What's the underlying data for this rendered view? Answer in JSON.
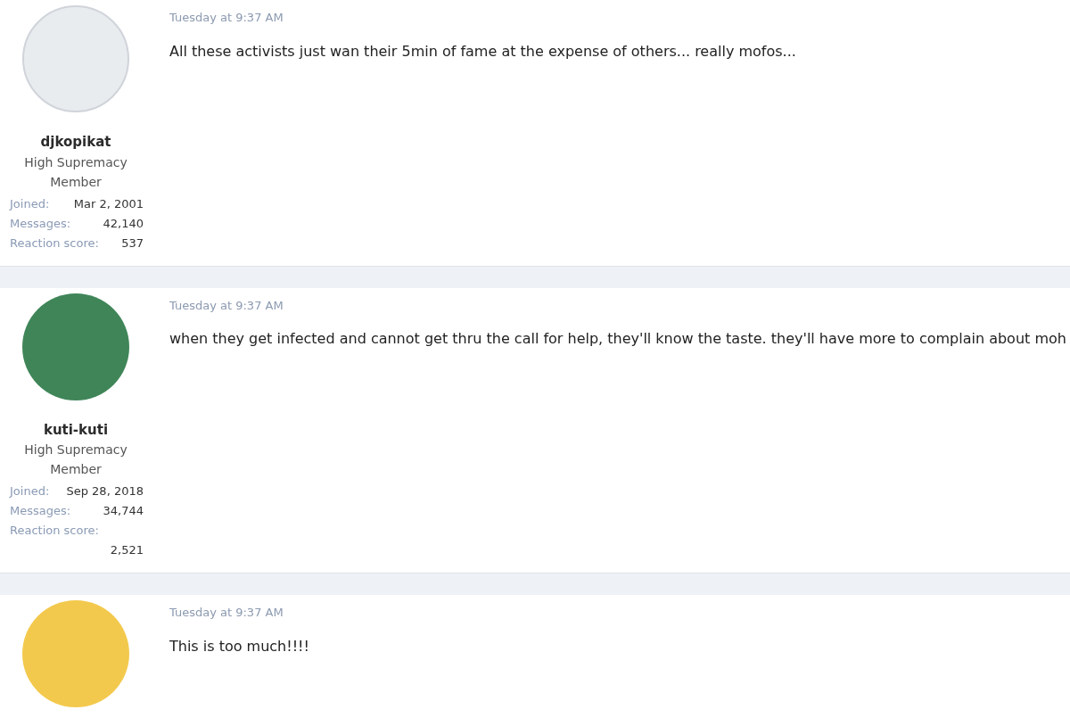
{
  "posts": [
    {
      "username": "djkopikat",
      "user_title": "High Supremacy Member",
      "stats": [
        {
          "label": "Joined:",
          "value": "Mar 2, 2001"
        },
        {
          "label": "Messages:",
          "value": "42,140"
        },
        {
          "label": "Reaction score:",
          "value": "537"
        }
      ],
      "date": "Tuesday at 9:37 AM",
      "message": "All these activists just wan their 5min of fame at the expense of others... really mofos..."
    },
    {
      "username": "kuti-kuti",
      "user_title": "High Supremacy Member",
      "stats": [
        {
          "label": "Joined:",
          "value": "Sep 28, 2018"
        },
        {
          "label": "Messages:",
          "value": "34,744"
        },
        {
          "label": "Reaction score:",
          "value": "2,521"
        }
      ],
      "date": "Tuesday at 9:37 AM",
      "message": "when they get infected and cannot get thru the call for help, they'll know the taste. they'll have more to complain about moh"
    },
    {
      "date": "Tuesday at 9:37 AM",
      "message": "This is too much!!!!"
    }
  ]
}
